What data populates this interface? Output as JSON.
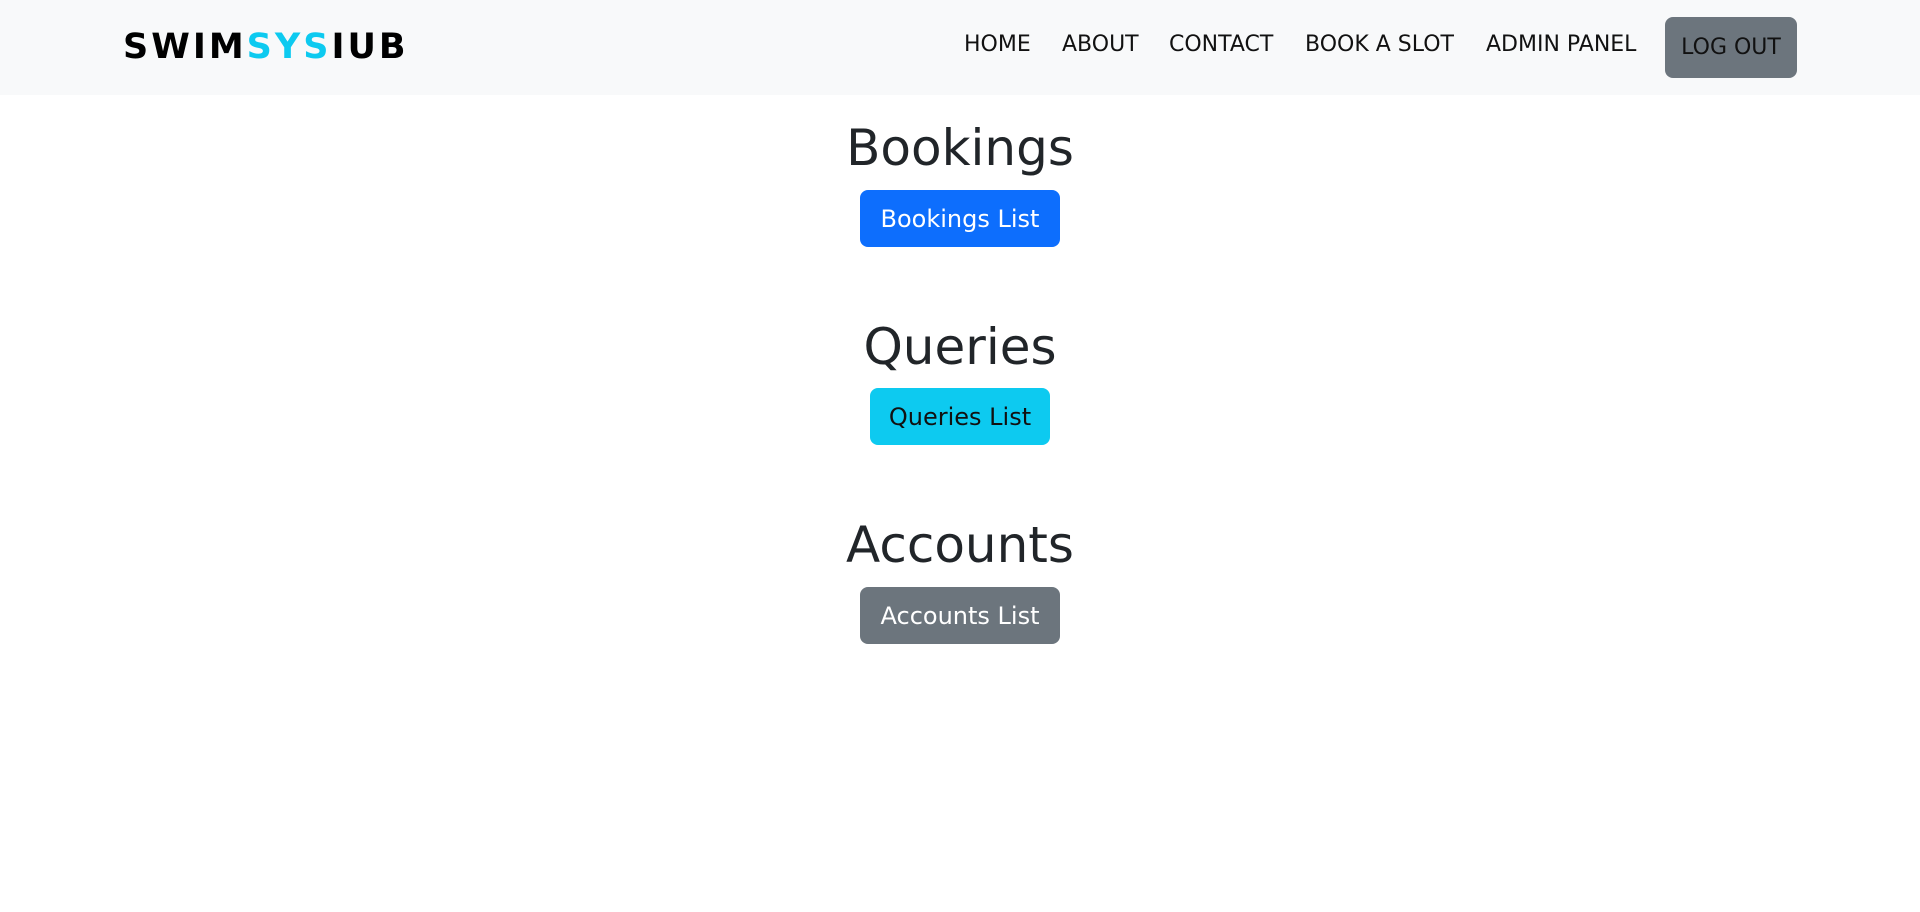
{
  "brand": {
    "part1": "SWIM",
    "part2": "SYS",
    "part3": "IUB",
    "accent_color": "#0dcaf0"
  },
  "nav": {
    "items": [
      {
        "label": "HOME"
      },
      {
        "label": "ABOUT"
      },
      {
        "label": "CONTACT"
      },
      {
        "label": "BOOK A SLOT"
      },
      {
        "label": "ADMIN PANEL"
      }
    ],
    "logout_label": "LOG OUT"
  },
  "sections": [
    {
      "title": "Bookings",
      "button_label": "Bookings List",
      "button_color": "#0d6efd"
    },
    {
      "title": "Queries",
      "button_label": "Queries List",
      "button_color": "#0dcaf0"
    },
    {
      "title": "Accounts",
      "button_label": "Accounts List",
      "button_color": "#6c757d"
    }
  ]
}
